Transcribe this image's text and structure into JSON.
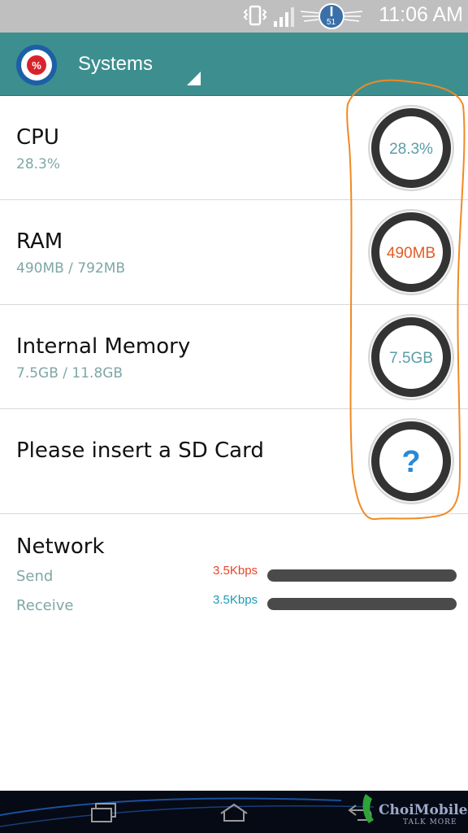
{
  "status_bar": {
    "time": "11:06 AM",
    "signal_badge": "51",
    "icons": [
      "vibrate-icon",
      "signal-icon",
      "dashboard-icon"
    ]
  },
  "action_bar": {
    "app_icon": "percent-icon",
    "title": "Systems"
  },
  "rows": [
    {
      "title": "CPU",
      "subtitle": "28.3%",
      "gauge_label": "28.3%",
      "gauge_color": "#5b9ea6"
    },
    {
      "title": "RAM",
      "subtitle": "490MB / 792MB",
      "gauge_label": "490MB",
      "gauge_color": "#e35b24"
    },
    {
      "title": "Internal Memory",
      "subtitle": "7.5GB / 11.8GB",
      "gauge_label": "7.5GB",
      "gauge_color": "#5b9ea6"
    },
    {
      "title": "Please insert a SD Card",
      "subtitle": "",
      "gauge_label": "?",
      "gauge_color": "#2a8ad6"
    }
  ],
  "network": {
    "title": "Network",
    "send_label": "Send",
    "send_rate": "3.5Kbps",
    "send_color": "#e8452a",
    "receive_label": "Receive",
    "receive_rate": "3.5Kbps",
    "receive_color": "#1f9bb8"
  },
  "nav_bar": {
    "icons": [
      "recent-apps-icon",
      "home-icon",
      "back-icon"
    ],
    "watermark": "ChoiMobile",
    "watermark_tagline": "TALK MORE"
  },
  "colors": {
    "action_bar": "#3d8f8f",
    "highlight_outline": "#f08a24"
  }
}
